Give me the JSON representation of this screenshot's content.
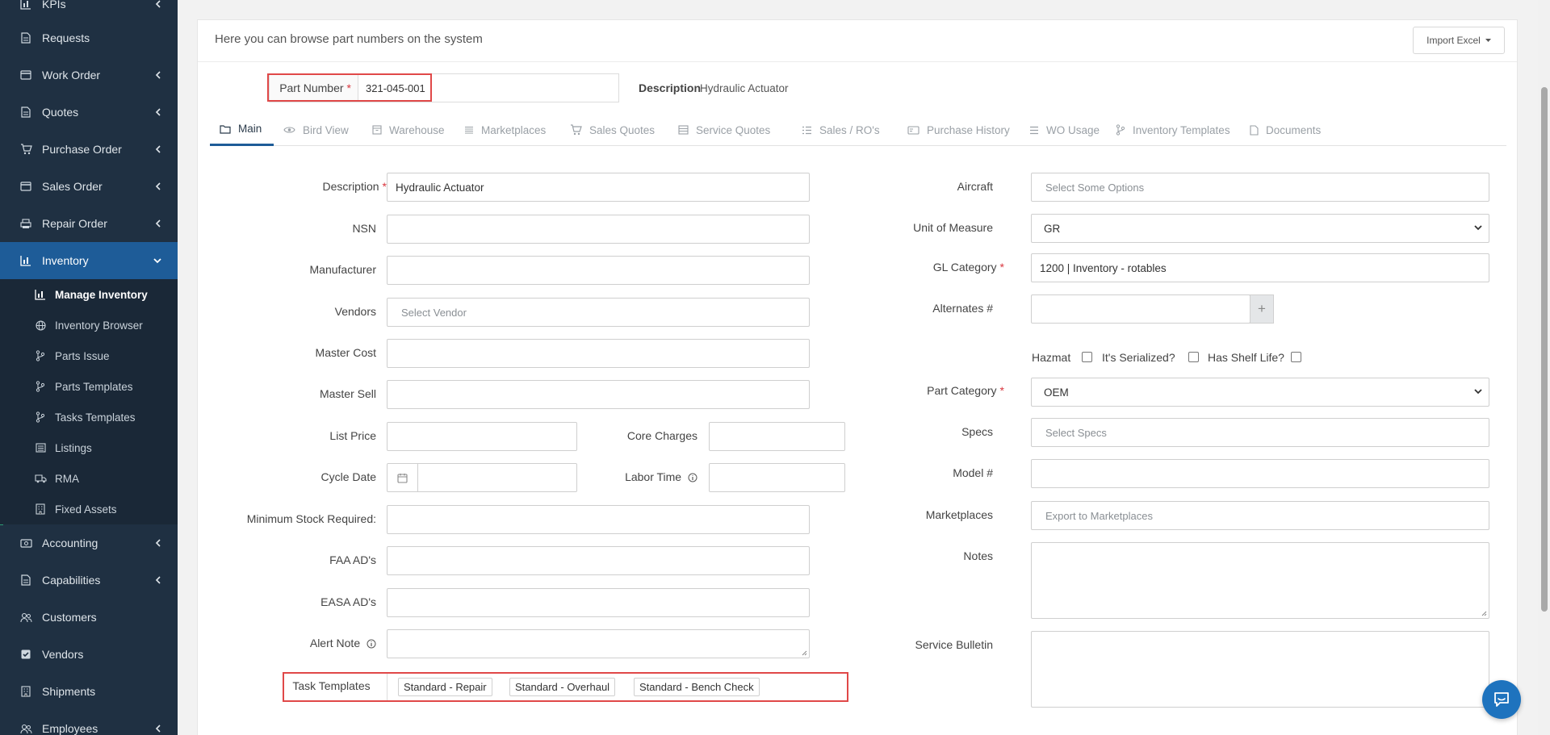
{
  "sidebar": {
    "items": [
      {
        "label": "KPIs",
        "icon": "chart-icon",
        "chevron": true
      },
      {
        "label": "Requests",
        "icon": "document-icon",
        "chevron": false
      },
      {
        "label": "Work Order",
        "icon": "card-icon",
        "chevron": true
      },
      {
        "label": "Quotes",
        "icon": "document-icon",
        "chevron": true
      },
      {
        "label": "Purchase Order",
        "icon": "cart-icon",
        "chevron": true
      },
      {
        "label": "Sales Order",
        "icon": "card-icon",
        "chevron": true
      },
      {
        "label": "Repair Order",
        "icon": "printer-icon",
        "chevron": true
      },
      {
        "label": "Inventory",
        "icon": "chart-icon",
        "chevron": true,
        "active": true
      },
      {
        "label": "Accounting",
        "icon": "money-icon",
        "chevron": true
      },
      {
        "label": "Capabilities",
        "icon": "document-icon",
        "chevron": true
      },
      {
        "label": "Customers",
        "icon": "users-icon",
        "chevron": false
      },
      {
        "label": "Vendors",
        "icon": "checkbox-icon",
        "chevron": false
      },
      {
        "label": "Shipments",
        "icon": "building-icon",
        "chevron": false
      },
      {
        "label": "Employees",
        "icon": "users-icon",
        "chevron": true
      }
    ],
    "sub_items": [
      {
        "label": "Manage Inventory",
        "icon": "chart-icon",
        "active": true
      },
      {
        "label": "Inventory Browser",
        "icon": "globe-icon"
      },
      {
        "label": "Parts Issue",
        "icon": "branch-icon"
      },
      {
        "label": "Parts Templates",
        "icon": "branch-icon"
      },
      {
        "label": "Tasks Templates",
        "icon": "branch-icon"
      },
      {
        "label": "Listings",
        "icon": "list-icon"
      },
      {
        "label": "RMA",
        "icon": "truck-icon"
      },
      {
        "label": "Fixed Assets",
        "icon": "building-icon"
      }
    ]
  },
  "header": {
    "subtitle": "Here you can browse part numbers on the system",
    "import_label": "Import Excel"
  },
  "part": {
    "label": "Part Number",
    "value": "321-045-001",
    "description_label": "Description",
    "description_value": "Hydraulic Actuator"
  },
  "tabs": [
    {
      "label": "Main",
      "icon": "folder-icon",
      "active": true
    },
    {
      "label": "Bird View",
      "icon": "eye-icon"
    },
    {
      "label": "Warehouse",
      "icon": "box-icon"
    },
    {
      "label": "Marketplaces",
      "icon": "list-icon"
    },
    {
      "label": "Sales Quotes",
      "icon": "cart-icon"
    },
    {
      "label": "Service Quotes",
      "icon": "table-icon"
    },
    {
      "label": "Sales / RO's",
      "icon": "checklist-icon"
    },
    {
      "label": "Purchase History",
      "icon": "card-icon"
    },
    {
      "label": "WO Usage",
      "icon": "list-icon"
    },
    {
      "label": "Inventory Templates",
      "icon": "branch-icon"
    },
    {
      "label": "Documents",
      "icon": "document-icon"
    }
  ],
  "form_left": {
    "description": {
      "label": "Description",
      "value": "Hydraulic Actuator"
    },
    "nsn": {
      "label": "NSN",
      "value": ""
    },
    "manufacturer": {
      "label": "Manufacturer",
      "value": ""
    },
    "vendors": {
      "label": "Vendors",
      "placeholder": "Select Vendor"
    },
    "master_cost": {
      "label": "Master Cost",
      "value": ""
    },
    "master_sell": {
      "label": "Master Sell",
      "value": ""
    },
    "list_price": {
      "label": "List Price",
      "value": ""
    },
    "core_charges": {
      "label": "Core Charges",
      "value": ""
    },
    "cycle_date": {
      "label": "Cycle Date",
      "value": ""
    },
    "labor_time": {
      "label": "Labor Time",
      "value": ""
    },
    "min_stock": {
      "label": "Minimum Stock Required:",
      "value": ""
    },
    "faa_ads": {
      "label": "FAA AD's",
      "value": ""
    },
    "easa_ads": {
      "label": "EASA AD's",
      "value": ""
    },
    "alert_note": {
      "label": "Alert Note",
      "value": ""
    },
    "task_templates": {
      "label": "Task Templates",
      "chips": [
        "Standard - Repair",
        "Standard - Overhaul",
        "Standard - Bench Check"
      ]
    }
  },
  "form_right": {
    "aircraft": {
      "label": "Aircraft",
      "placeholder": "Select Some Options"
    },
    "uom": {
      "label": "Unit of Measure",
      "value": "GR"
    },
    "gl_category": {
      "label": "GL Category",
      "value": "1200 | Inventory - rotables"
    },
    "alternates": {
      "label": "Alternates #",
      "value": "",
      "add_symbol": "+"
    },
    "hazmat": {
      "label": "Hazmat",
      "checked": false
    },
    "serialized": {
      "label": "It's Serialized?",
      "checked": false
    },
    "shelf_life": {
      "label": "Has Shelf Life?",
      "checked": false
    },
    "part_category": {
      "label": "Part Category",
      "value": "OEM"
    },
    "specs": {
      "label": "Specs",
      "placeholder": "Select Specs"
    },
    "model": {
      "label": "Model #",
      "value": ""
    },
    "marketplaces": {
      "label": "Marketplaces",
      "placeholder": "Export to Marketplaces"
    },
    "notes": {
      "label": "Notes",
      "value": ""
    },
    "service_bulletin": {
      "label": "Service Bulletin",
      "value": ""
    }
  },
  "colors": {
    "sidebar_bg": "#1f3042",
    "active_nav": "#1e5c98",
    "required": "#d9363e",
    "highlight": "#e04848",
    "chat": "#1e73be"
  }
}
